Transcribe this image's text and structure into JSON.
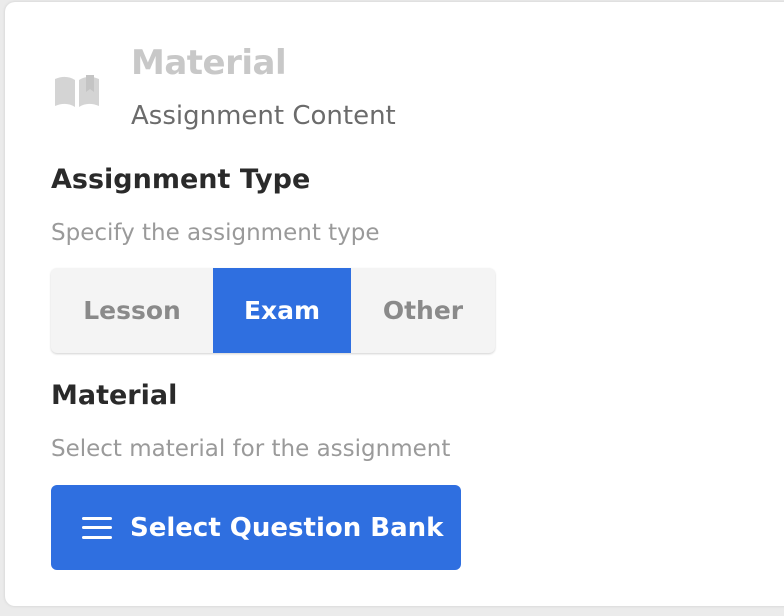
{
  "section": {
    "icon": "book-icon",
    "title": "Material",
    "subtitle": "Assignment Content"
  },
  "assignment_type": {
    "label": "Assignment Type",
    "help": "Specify the assignment type",
    "options": [
      {
        "label": "Lesson",
        "selected": false
      },
      {
        "label": "Exam",
        "selected": true
      },
      {
        "label": "Other",
        "selected": false
      }
    ]
  },
  "material": {
    "label": "Material",
    "help": "Select material for the assignment",
    "button_icon": "menu-icon",
    "button_label": "Select Question Bank"
  },
  "colors": {
    "accent": "#2f6fe0",
    "background": "#ebebeb",
    "card": "#ffffff",
    "muted_text": "#9a9a9a",
    "segment_bg": "#f4f4f4"
  }
}
